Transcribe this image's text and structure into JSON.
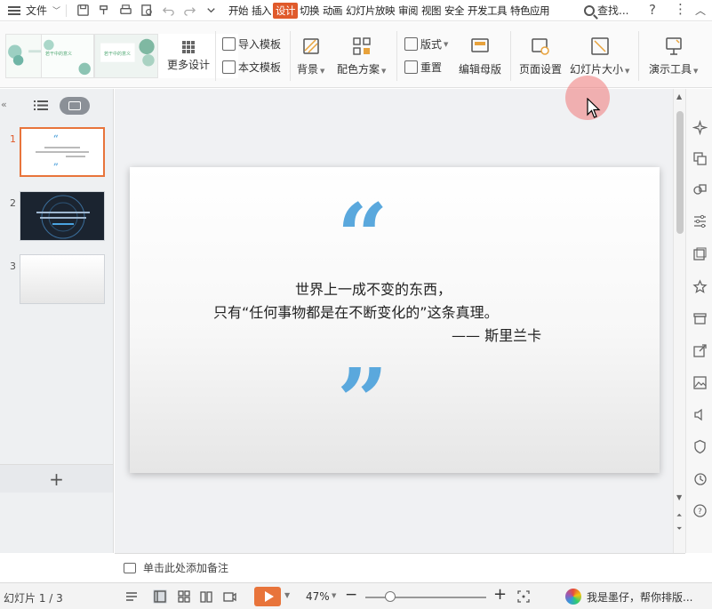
{
  "menubar": {
    "file_label": "文件",
    "tabs": [
      "开始",
      "插入",
      "设计",
      "切换",
      "动画",
      "幻灯片放映",
      "审阅",
      "视图",
      "安全",
      "开发工具",
      "特色应用"
    ],
    "active_tab": "设计",
    "search_label": "查找..."
  },
  "ribbon": {
    "more_design": "更多设计",
    "import_template": "导入模板",
    "this_template": "本文模板",
    "background": "背景",
    "color_scheme": "配色方案",
    "layout": "版式",
    "reset": "重置",
    "edit_master": "编辑母版",
    "page_setup": "页面设置",
    "slide_size": "幻灯片大小",
    "presentation_tools": "演示工具",
    "theme_captions": [
      "若干中的意义",
      "若干中的意义"
    ]
  },
  "slides_panel": {
    "numbers": [
      "1",
      "2",
      "3"
    ],
    "active_index": 0
  },
  "slide": {
    "line1": "世界上一成不变的东西，",
    "line2": "只有“任何事物都是在不断变化的”这条真理。",
    "attribution": "—— 斯里兰卡"
  },
  "notes": {
    "placeholder": "单击此处添加备注"
  },
  "statusbar": {
    "page_info": "幻灯片 1 / 3",
    "zoom": "47%",
    "zoom_level_percent": 47,
    "assistant_text": "我是墨仔，帮你排版..."
  },
  "colors": {
    "accent": "#e05a2b",
    "quote_blue": "#5aa8dd",
    "play_orange": "#e8743b"
  }
}
